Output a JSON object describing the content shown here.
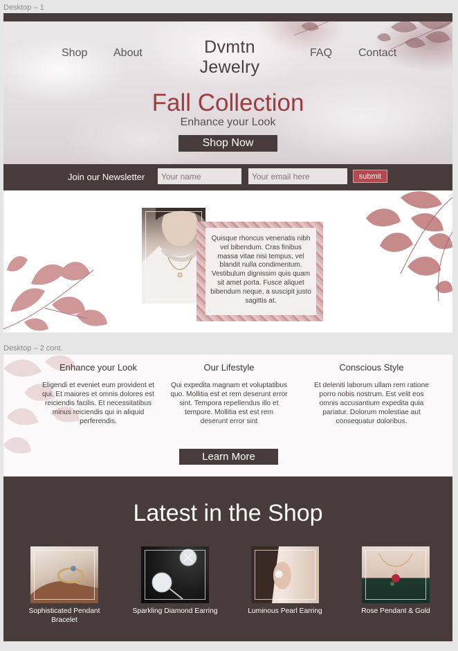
{
  "canvas": {
    "frame1_label": "Desktop – 1",
    "frame2_label": "Desktop – 2 cont."
  },
  "header": {
    "nav_left": [
      "Shop",
      "About"
    ],
    "brand": "Dvmtn Jewelry",
    "nav_right": [
      "FAQ",
      "Contact"
    ]
  },
  "hero": {
    "title": "Fall Collection",
    "subtitle": "Enhance your Look",
    "cta": "Shop Now"
  },
  "newsletter": {
    "label": "Join our Newsletter",
    "name_placeholder": "Your name",
    "email_placeholder": "Your email here",
    "submit": "submit"
  },
  "feature": {
    "quote": "Quisque rhoncus venenatis nibh vel bibendum. Cras finibus massa vitae nisi tempus, vel blandit nulla condimentum. Vestibulum dignissim quis quam sit amet porta. Fusce aliquet bibendum neque, a suscipit justo sagittis at."
  },
  "columns": [
    {
      "title": "Enhance your Look",
      "body": "Eligendi et eveniet eum provident et qui. Et maiores et omnis dolores est reiciendis facilis. Et necessitatibus minus reiciendis qui in aliquid perferendis."
    },
    {
      "title": "Our Lifestyle",
      "body": "Qui expedita magnam et voluptatibus quo. Mollitia est et rem deserunt error sint. Tempora repellendus illo et tempore. Mollitia est est rem deserunt error sint"
    },
    {
      "title": "Conscious Style",
      "body": "Et deleniti laborum ullam rem ratione porro nobis nostrum. Est velit eos omnis accusantium expedita quia pariatur. Dolorum molestiae aut consequatur doloribus."
    }
  ],
  "learn_more": "Learn More",
  "shop": {
    "title": "Latest in the Shop",
    "products": [
      {
        "name": "Sophisticated Pendant Bracelet"
      },
      {
        "name": "Sparkling Diamond Earring"
      },
      {
        "name": "Luminous Pearl Earring"
      },
      {
        "name": "Rose Pendant & Gold"
      }
    ]
  },
  "colors": {
    "dark": "#473b3b",
    "accent": "#9d3b3e",
    "submit": "#b44a4d",
    "leaf": "#c07a7b"
  }
}
